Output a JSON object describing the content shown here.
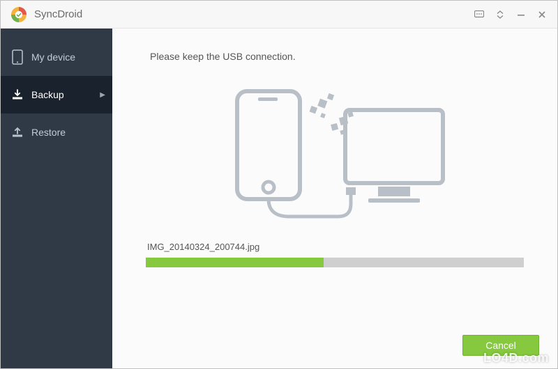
{
  "app": {
    "title": "SyncDroid"
  },
  "sidebar": {
    "items": [
      {
        "label": "My device"
      },
      {
        "label": "Backup"
      },
      {
        "label": "Restore"
      }
    ]
  },
  "main": {
    "instruction": "Please keep the USB connection.",
    "current_file": "IMG_20140324_200744.jpg",
    "progress_percent": 47,
    "cancel_label": "Cancel"
  },
  "colors": {
    "accent_green": "#86c93e",
    "sidebar_bg": "#2f3a46",
    "sidebar_active": "#1a232d"
  },
  "watermark": "LO4D.com"
}
